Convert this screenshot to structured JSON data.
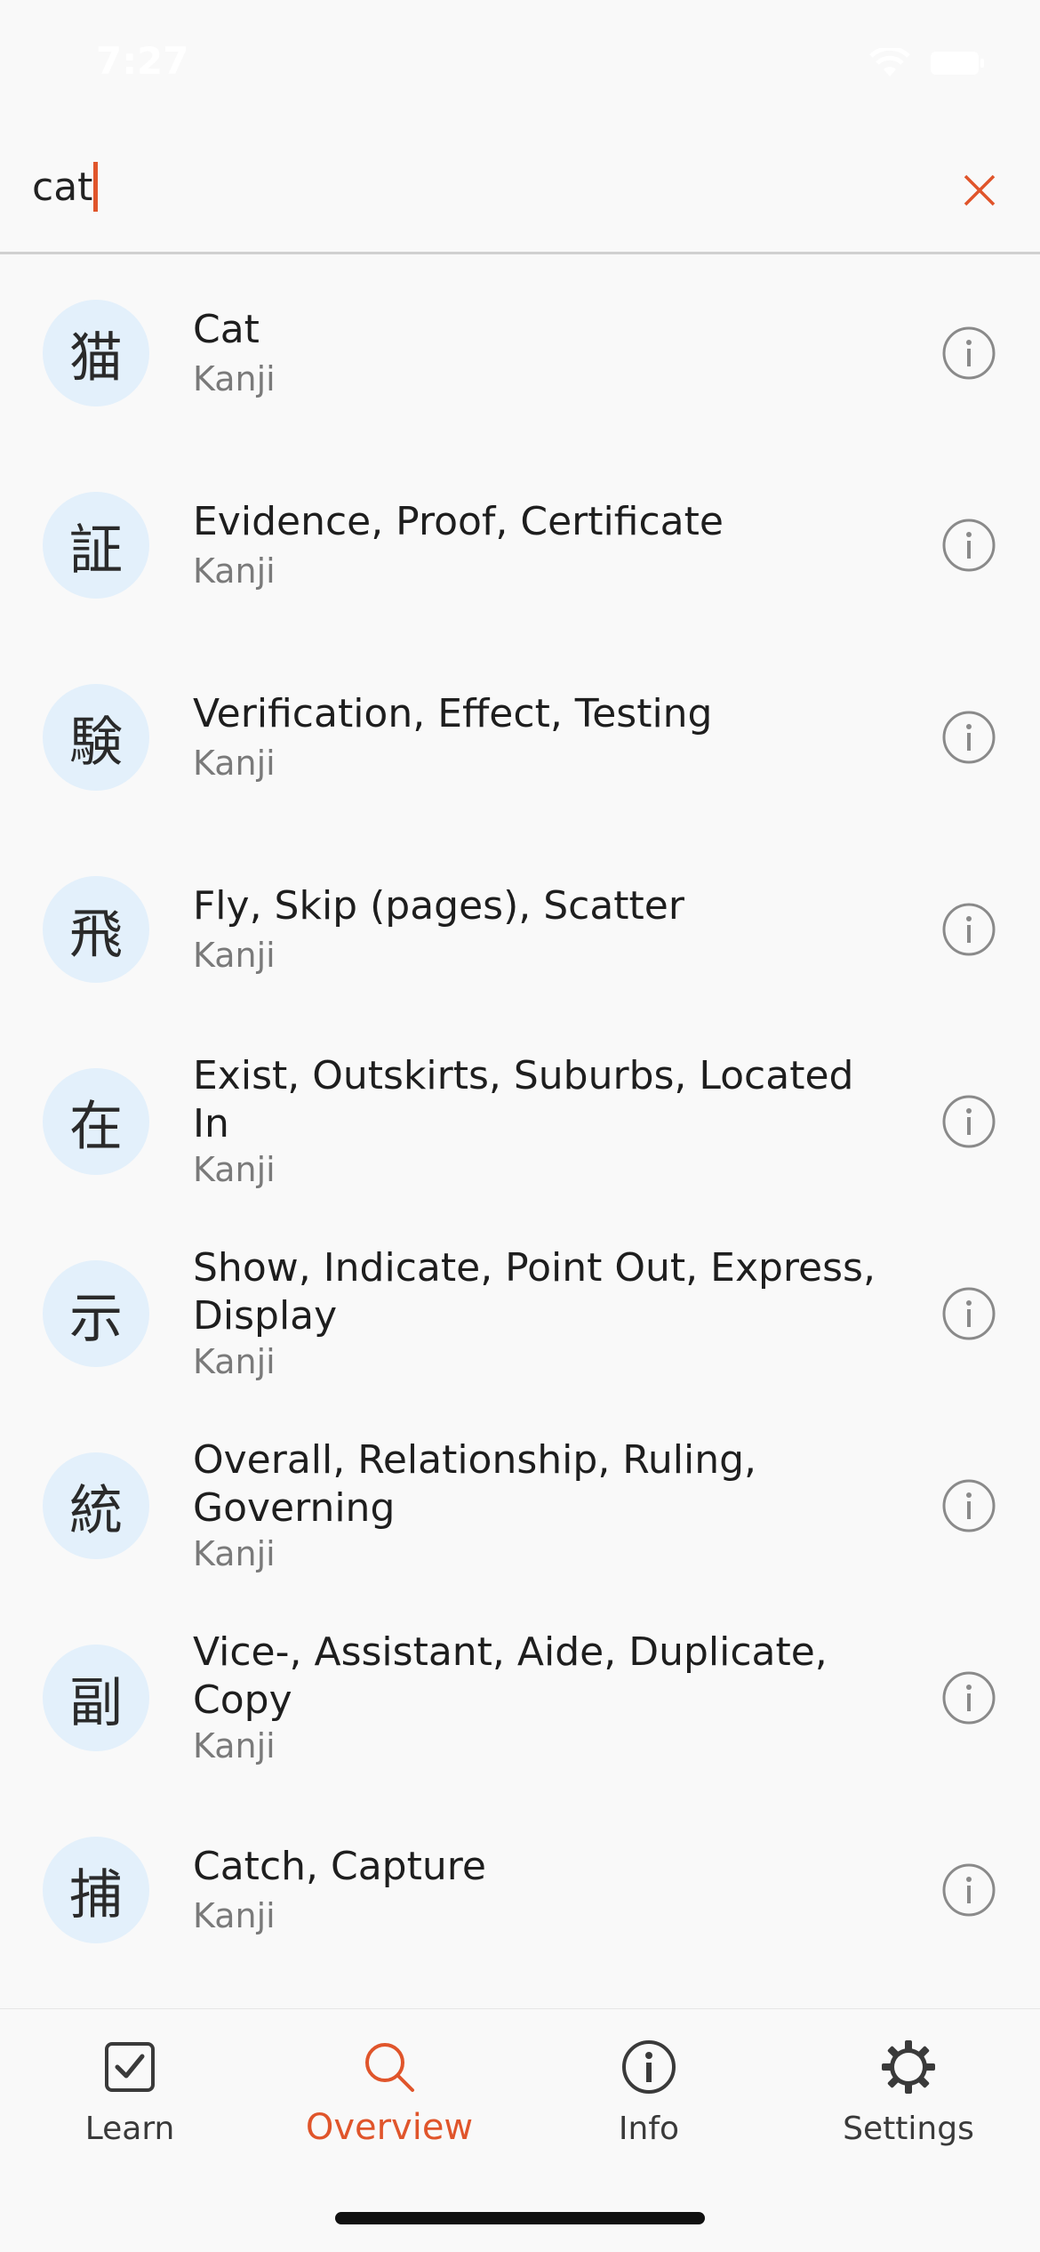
{
  "status_bar": {
    "time": "7:27"
  },
  "search": {
    "query": "cat"
  },
  "colors": {
    "accent": "#e0552b",
    "badge_bg": "#e3f0fb",
    "text": "#1e1e1e",
    "subtext": "#7a7a7a"
  },
  "results": [
    {
      "kanji": "猫",
      "meaning": "Cat",
      "type": "Kanji"
    },
    {
      "kanji": "証",
      "meaning": "Evidence, Proof, Certificate",
      "type": "Kanji"
    },
    {
      "kanji": "験",
      "meaning": "Verification, Effect, Testing",
      "type": "Kanji"
    },
    {
      "kanji": "飛",
      "meaning": "Fly, Skip (pages), Scatter",
      "type": "Kanji"
    },
    {
      "kanji": "在",
      "meaning": "Exist, Outskirts, Suburbs, Located In",
      "type": "Kanji"
    },
    {
      "kanji": "示",
      "meaning": "Show, Indicate, Point Out, Express, Display",
      "type": "Kanji"
    },
    {
      "kanji": "統",
      "meaning": "Overall, Relationship, Ruling, Governing",
      "type": "Kanji"
    },
    {
      "kanji": "副",
      "meaning": "Vice-, Assistant, Aide, Duplicate, Copy",
      "type": "Kanji"
    },
    {
      "kanji": "捕",
      "meaning": "Catch, Capture",
      "type": "Kanji"
    }
  ],
  "tab_bar": {
    "tabs": [
      {
        "label": "Learn",
        "icon": "checkbox-icon",
        "active": false
      },
      {
        "label": "Overview",
        "icon": "search-icon",
        "active": true
      },
      {
        "label": "Info",
        "icon": "info-icon",
        "active": false
      },
      {
        "label": "Settings",
        "icon": "gear-icon",
        "active": false
      }
    ]
  }
}
